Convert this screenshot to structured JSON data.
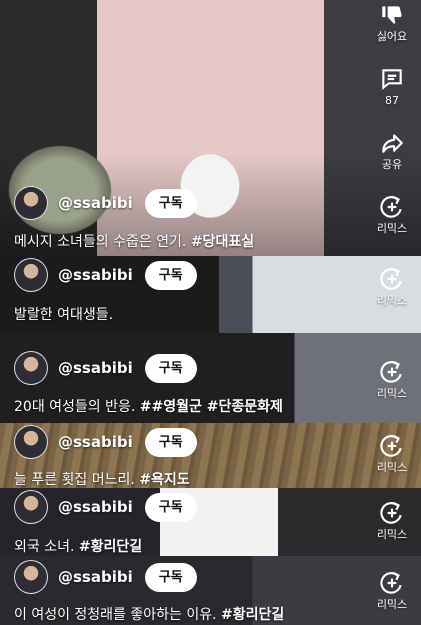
{
  "channel_name": "@ssabibi",
  "subscribe_label": "구독",
  "actions": {
    "dislike_label": "싫어요",
    "comment_count": "87",
    "share_label": "공유",
    "remix_label": "리믹스"
  },
  "feed": [
    {
      "caption": "메시지 소녀들의 수줍은 연기.",
      "tags": "#당대표실"
    },
    {
      "caption": "발랄한 여대생들.",
      "tags": ""
    },
    {
      "caption": "20대 여성들의 반응.",
      "tags": "##영월군 #단종문화제"
    },
    {
      "caption": "늘 푸른 횟집  머느리.",
      "tags": "#욕지도"
    },
    {
      "caption": "외국 소녀.",
      "tags": "#황리단길"
    },
    {
      "caption": "이 여성이 정청래를 좋아하는 이유.",
      "tags": "#황리단길"
    }
  ]
}
